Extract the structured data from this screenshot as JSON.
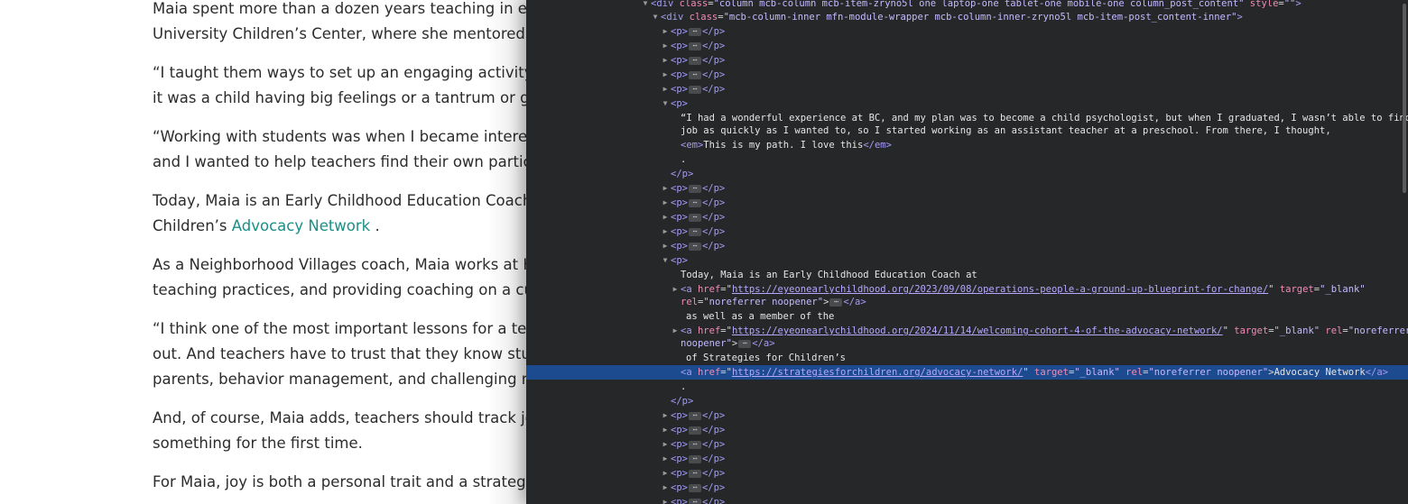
{
  "article": {
    "paragraphs": [
      {
        "lines": [
          "Maia spent more than a dozen years teaching in ear",
          "University Children’s Center, where she mentored co"
        ]
      },
      {
        "lines": [
          "“I taught them ways to set up an engaging activity, h",
          "it was a child having big feelings or a tantrum or goi"
        ]
      },
      {
        "lines": [
          "“Working with students was when I became intereste",
          "and I wanted to help teachers find their own particu"
        ]
      },
      {
        "lines": [
          "Today, Maia is an Early Childhood Education Coach"
        ],
        "line2_prefix": "Children’s ",
        "line2_link": "Advocacy Network",
        "line2_suffix": " ."
      },
      {
        "lines": [
          "As a Neighborhood Villages coach, Maia works at Ha",
          "teaching practices, and providing coaching on a cu"
        ]
      },
      {
        "lines": [
          "“I think one of the most important lessons for a teach",
          "out. And teachers have to trust that they know stude",
          "parents, behavior management, and challenging m"
        ]
      },
      {
        "lines": [
          "And, of course, Maia adds, teachers should track joy",
          "something for the first time."
        ]
      },
      {
        "lines": [
          "For Maia, joy is both a personal trait and a strategy."
        ]
      }
    ]
  },
  "devtools": {
    "top_div": {
      "open": "<div",
      "class_attr": "class",
      "class_val": "\"column mcb-column mcb-item-zryno5l one laptop-one tablet-one mobile-one column_post_content\"",
      "style_attr": "style",
      "style_val": "\"\"",
      "close": ">"
    },
    "inner_div": {
      "open": "<div",
      "class_attr": "class",
      "class_val": "\"mcb-column-inner mfn-module-wrapper mcb-column-inner-zryno5l mcb-item-post_content-inner\"",
      "close": ">"
    },
    "p_open": "<p>",
    "p_close": "</p>",
    "ellipsis": "⋯",
    "quote_lines": [
      "“I had a wonderful experience at BC, and my plan was to become a child psychologist, but when I graduated, I wasn’t able to find a",
      "job as quickly as I wanted to, so I started working as an assistant teacher at a preschool. From there, I thought,"
    ],
    "em_open": "<em>",
    "em_text": "This is my path. I love this",
    "em_close": "</em>",
    "period": ".",
    "today_text": "Today, Maia is an Early Childhood Education Coach at",
    "a_open": "<a",
    "href_attr": "href",
    "href1": "https://eyeonearlychildhood.org/2023/09/08/operations-people-a-ground-up-blueprint-for-change/",
    "target_attr": "target",
    "target_val": "\"_blank\"",
    "rel_attr": "rel",
    "rel_val": "\"noreferrer noopener\"",
    "a_close": "</a>",
    "member_text": "as well as a member of the",
    "href2": "https://eyeonearlychildhood.org/2024/11/14/welcoming-cohort-4-of-the-advocacy-network/",
    "rel_val_part1": "\"noreferrer",
    "rel_val_part2": "noopener\"",
    "strategies_text": "of Strategies for Children’s",
    "href3": "https://strategiesforchildren.org/advocacy-network/",
    "link3_text": "Advocacy Network"
  }
}
